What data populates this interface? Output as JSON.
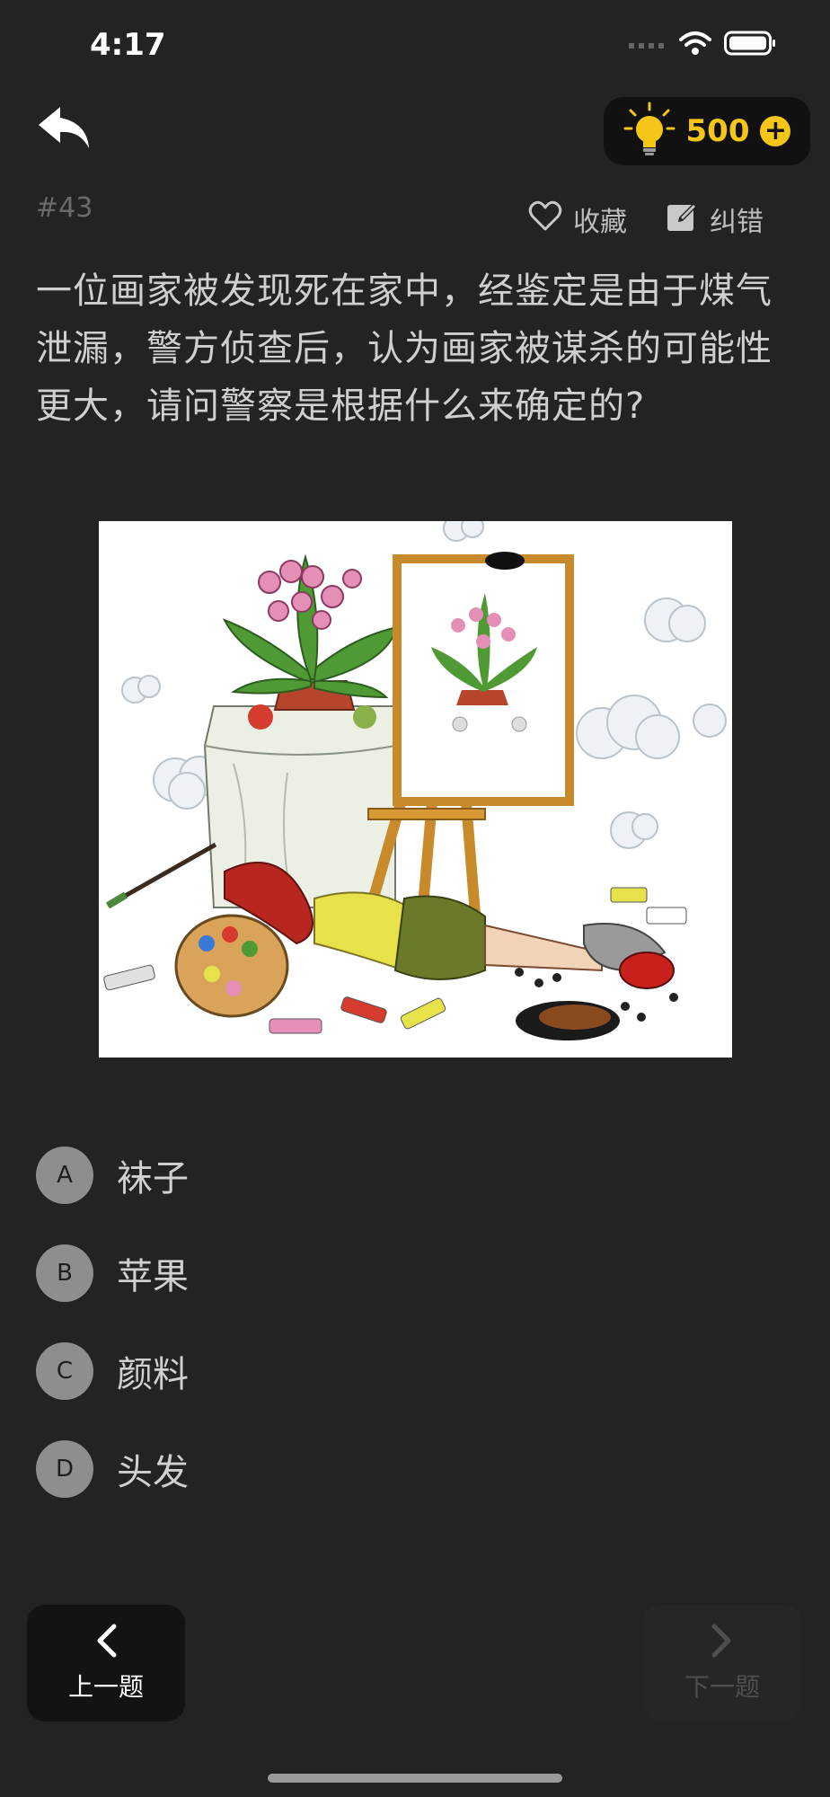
{
  "status_bar": {
    "time": "4:17"
  },
  "header": {
    "hint_count": "500",
    "plus_symbol": "+"
  },
  "question": {
    "number": "#43",
    "favorite_label": "收藏",
    "report_label": "纠错",
    "text": "一位画家被发现死在家中，经鉴定是由于煤气泄漏，警方侦查后，认为画家被谋杀的可能性更大，请问警察是根据什么来确定的?"
  },
  "options": [
    {
      "letter": "A",
      "text": "袜子"
    },
    {
      "letter": "B",
      "text": "苹果"
    },
    {
      "letter": "C",
      "text": "颜料"
    },
    {
      "letter": "D",
      "text": "头发"
    }
  ],
  "navigation": {
    "prev_label": "上一题",
    "next_label": "下一题"
  },
  "colors": {
    "background": "#232323",
    "accent": "#f5c518",
    "disabled": "#4e4e4e"
  },
  "icons": {
    "back": "reply-arrow-icon",
    "hint": "lightbulb-icon",
    "favorite": "heart-icon",
    "report": "edit-icon",
    "prev": "chevron-left-icon",
    "next": "chevron-right-icon"
  }
}
